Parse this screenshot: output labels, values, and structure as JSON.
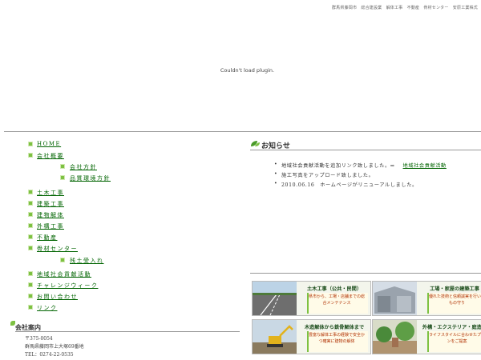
{
  "topnav": "群馬県藤岡市　総合建設業　解体工事　不動産　骨材センター　安原工業株式",
  "plugin_message": "Couldn't load plugin.",
  "sidebar": {
    "items": [
      {
        "label": "HOME"
      },
      {
        "label": "会社概要"
      },
      {
        "label": "会社方針"
      },
      {
        "label": "品質環境方針"
      },
      {
        "label": "土木工事"
      },
      {
        "label": "建築工事"
      },
      {
        "label": "建物解体"
      },
      {
        "label": "外構工事"
      },
      {
        "label": "不動産"
      },
      {
        "label": "骨材センター"
      },
      {
        "label": "残土受入れ"
      },
      {
        "label": "地域社会貢献活動"
      },
      {
        "label": "チャレンジウィーク"
      },
      {
        "label": "お問い合わせ"
      },
      {
        "label": "リンク"
      }
    ]
  },
  "company": {
    "heading": "会社案内",
    "postal": "〒375-0054",
    "address": "群馬県藤岡市上大塚69番地",
    "tel": "TEL：0274-22-0535"
  },
  "news": {
    "title": "お知らせ",
    "items": [
      {
        "text": "地域社会貢献活動を追加リンク致しました。⇒",
        "link": "地域社会貢献活動"
      },
      {
        "text": "施工写真をアップロード致しました。",
        "link": ""
      },
      {
        "text": "2010.06.16　ホームページがリニューアルしました。",
        "link": ""
      }
    ]
  },
  "banners": [
    {
      "title": "土木工事（公共・民間）",
      "sub": "県市から、工場・店舗までの総合メンテナンス"
    },
    {
      "title": "工場・家屋の建築工事",
      "sub": "優れた技術と信頼誠実を行いをもの守り"
    },
    {
      "title": "木造解体から鉄骨解体まで",
      "sub": "豊富な解体工事の経験で安全かつ確実に建物の解体"
    },
    {
      "title": "外構・エクステリア・庭造り",
      "sub": "ライフスタイルに合わせたプランをご提案"
    }
  ],
  "colors": {
    "link": "#006400",
    "bullet": "#7dc142",
    "banner_title": "#1a4c1a",
    "banner_sub": "#b03000"
  }
}
